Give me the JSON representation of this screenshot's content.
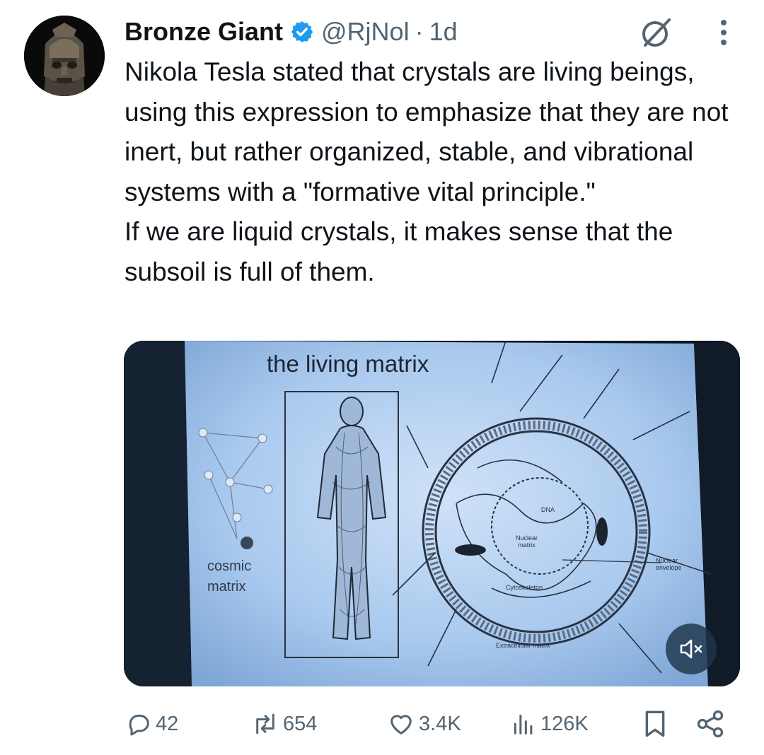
{
  "author": {
    "name": "Bronze Giant",
    "handle": "@RjNol",
    "separator": "·",
    "time": "1d",
    "avatar_icon": "bronze-mask-avatar",
    "verified_icon": "verified-badge-icon"
  },
  "tweet": {
    "paragraph_1": "Nikola Tesla stated that crystals are living beings, using this expression to emphasize that they are not inert, but rather organized, stable, and vibrational systems with a \"formative vital principle.\"",
    "paragraph_2": "If we are liquid crystals, it makes sense that the subsoil is full of them."
  },
  "media": {
    "slide_title": "the living matrix",
    "cosmic_label_1": "cosmic",
    "cosmic_label_2": "matrix",
    "label_dna": "DNA",
    "label_nuclear_matrix_1": "Nuclear",
    "label_nuclear_matrix_2": "matrix",
    "label_nuclear_envelope_1": "Nuclear",
    "label_nuclear_envelope_2": "envelope",
    "label_cytoskeleton": "Cytoskeleton",
    "label_extracellular": "Extracellular matrix",
    "mute_icon": "speaker-muted-icon"
  },
  "actions": {
    "replies": "42",
    "reposts": "654",
    "likes": "3.4K",
    "views": "126K"
  },
  "colors": {
    "text_primary": "#0f1419",
    "text_secondary": "#536471",
    "verified": "#1d9bf0",
    "slide_bg": "#a8c8ee"
  }
}
